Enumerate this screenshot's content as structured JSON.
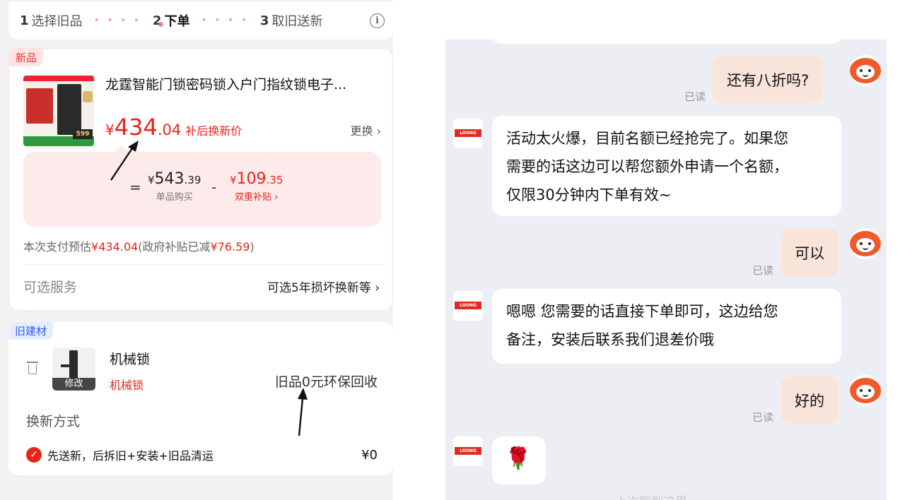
{
  "steps": [
    {
      "n": "1",
      "label": "选择旧品"
    },
    {
      "n": "2",
      "label": "下单"
    },
    {
      "n": "3",
      "label": "取旧送新"
    }
  ],
  "step_dots": "• • • •",
  "info_icon_glyph": "i",
  "new_item": {
    "tag": "新品",
    "title": "龙霆智能门锁密码锁入户门指纹锁电子...",
    "price_currency": "¥",
    "price_int": "434",
    "price_dec": ".04",
    "price_label": "补后换新价",
    "change_label": "更换",
    "change_chevron": "›",
    "thumb_badge": "599",
    "equals": "=",
    "minus": "-",
    "unit_price_cur": "¥",
    "unit_price_int": "543",
    "unit_price_dec": ".39",
    "unit_price_label": "单品购买",
    "subsidy_cur": "¥",
    "subsidy_int": "109",
    "subsidy_dec": ".35",
    "subsidy_label": "双重补贴 ›",
    "pay_prefix": "本次支付预估",
    "pay_amount": "¥434.04",
    "pay_note_a": "(政府补贴已减",
    "pay_saved": "¥76.59",
    "pay_note_b": ")",
    "service_label": "可选服务",
    "service_value": "可选5年损坏换新等",
    "service_chevron": "›"
  },
  "old_item": {
    "tag": "旧建材",
    "name": "机械锁",
    "type": "机械锁",
    "edit_label": "修改",
    "recycle_a": "旧品",
    "recycle_num": "0",
    "recycle_b": "元环保回收",
    "method_label": "换新方式",
    "option_check": "✓",
    "option_label": "先送新，后拆旧+安装+旧品清运",
    "option_price": "¥0"
  },
  "chat": {
    "messages": [
      {
        "side": "right",
        "text": "还有八折吗?",
        "read": "已读"
      },
      {
        "side": "left",
        "lines": [
          "活动太火爆，目前名额已经抢完了。如果您",
          "需要的话这边可以帮您额外申请一个名额，",
          "仅限30分钟内下单有效~"
        ]
      },
      {
        "side": "right",
        "text": "可以",
        "read": "已读"
      },
      {
        "side": "left",
        "lines": [
          "嗯嗯 您需要的话直接下单即可，这边给您",
          "备注，安装后联系我们退差价哦"
        ]
      },
      {
        "side": "right",
        "text": "好的",
        "read": "已读"
      },
      {
        "side": "left",
        "emoji": "🌹"
      }
    ],
    "logo_text": "LOONG",
    "bottom_hint": "上次聊到这里"
  },
  "colors": {
    "accent": "#e8251b",
    "chat_bg": "#ededf4",
    "self_bubble": "#f9e4da"
  }
}
